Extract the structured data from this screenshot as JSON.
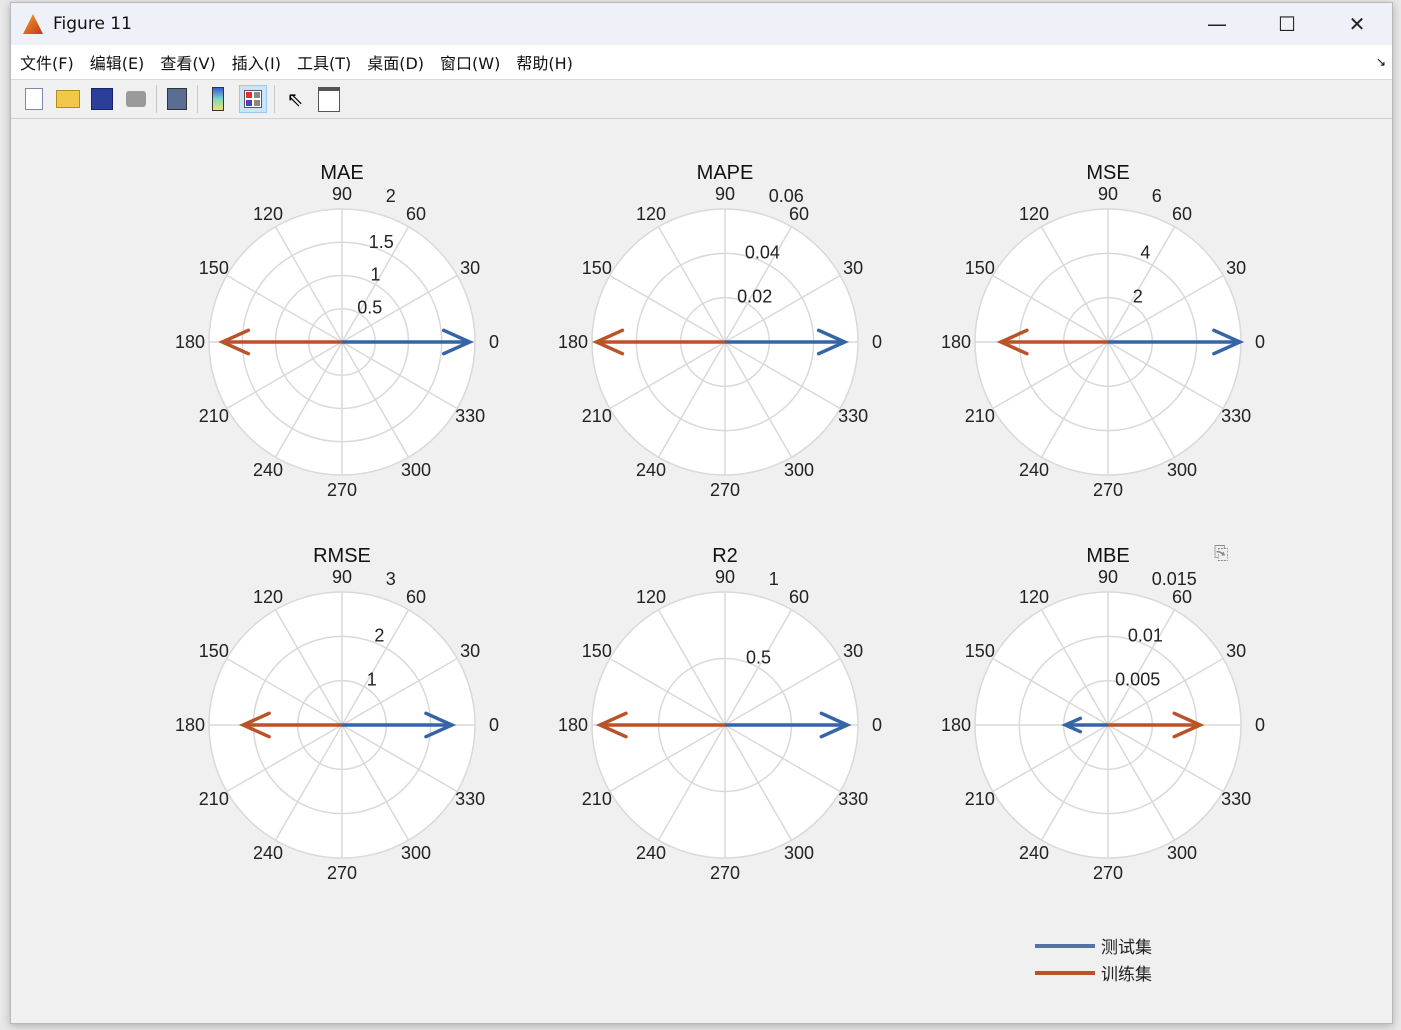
{
  "window": {
    "title": "Figure 11",
    "minimize": "—",
    "maximize": "☐",
    "close": "✕"
  },
  "menu": [
    "文件(F)",
    "编辑(E)",
    "查看(V)",
    "插入(I)",
    "工具(T)",
    "桌面(D)",
    "窗口(W)",
    "帮助(H)"
  ],
  "toolbar": [
    "new-figure-icon",
    "open-file-icon",
    "save-icon",
    "print-icon",
    "link-icon",
    "colorbar-icon",
    "legend-icon",
    "pointer-icon",
    "property-editor-icon"
  ],
  "colors": {
    "test": "#3565a6",
    "train": "#b9542a",
    "grid": "#d9d9d9"
  },
  "chart_data": [
    {
      "type": "compass",
      "title": "MAE",
      "rmax": 2,
      "rticks": [
        "0.5",
        "1",
        "1.5",
        "2"
      ],
      "theta_ticks": [
        0,
        30,
        60,
        90,
        120,
        150,
        180,
        210,
        240,
        270,
        300,
        330
      ],
      "series": [
        {
          "name": "测试集",
          "angle": 0,
          "value": 1.92
        },
        {
          "name": "训练集",
          "angle": 180,
          "value": 1.8
        }
      ]
    },
    {
      "type": "compass",
      "title": "MAPE",
      "rmax": 0.06,
      "rticks": [
        "0.02",
        "0.04",
        "0.06"
      ],
      "theta_ticks": [
        0,
        30,
        60,
        90,
        120,
        150,
        180,
        210,
        240,
        270,
        300,
        330
      ],
      "series": [
        {
          "name": "测试集",
          "angle": 0,
          "value": 0.054
        },
        {
          "name": "训练集",
          "angle": 180,
          "value": 0.058
        }
      ]
    },
    {
      "type": "compass",
      "title": "MSE",
      "rmax": 6,
      "rticks": [
        "2",
        "4",
        "6"
      ],
      "theta_ticks": [
        0,
        30,
        60,
        90,
        120,
        150,
        180,
        210,
        240,
        270,
        300,
        330
      ],
      "series": [
        {
          "name": "测试集",
          "angle": 0,
          "value": 5.95
        },
        {
          "name": "训练集",
          "angle": 180,
          "value": 4.83
        }
      ]
    },
    {
      "type": "compass",
      "title": "RMSE",
      "rmax": 3,
      "rticks": [
        "1",
        "2",
        "3"
      ],
      "theta_ticks": [
        0,
        30,
        60,
        90,
        120,
        150,
        180,
        210,
        240,
        270,
        300,
        330
      ],
      "series": [
        {
          "name": "测试集",
          "angle": 0,
          "value": 2.48
        },
        {
          "name": "训练集",
          "angle": 180,
          "value": 2.23
        }
      ]
    },
    {
      "type": "compass",
      "title": "R2",
      "rmax": 1,
      "rticks": [
        "0.5",
        "1"
      ],
      "theta_ticks": [
        0,
        30,
        60,
        90,
        120,
        150,
        180,
        210,
        240,
        270,
        300,
        330
      ],
      "series": [
        {
          "name": "测试集",
          "angle": 0,
          "value": 0.92
        },
        {
          "name": "训练集",
          "angle": 180,
          "value": 0.94
        }
      ]
    },
    {
      "type": "compass",
      "title": "MBE",
      "rmax": 0.015,
      "rticks": [
        "0.005",
        "0.01",
        "0.015"
      ],
      "theta_ticks": [
        0,
        30,
        60,
        90,
        120,
        150,
        180,
        210,
        240,
        270,
        300,
        330
      ],
      "series": [
        {
          "name": "测试集",
          "angle": 180,
          "value": 0.0048
        },
        {
          "name": "训练集",
          "angle": 0,
          "value": 0.0104
        }
      ]
    }
  ],
  "legend": {
    "placement": "bottom-right",
    "items": [
      {
        "label": "测试集"
      },
      {
        "label": "训练集"
      }
    ]
  }
}
